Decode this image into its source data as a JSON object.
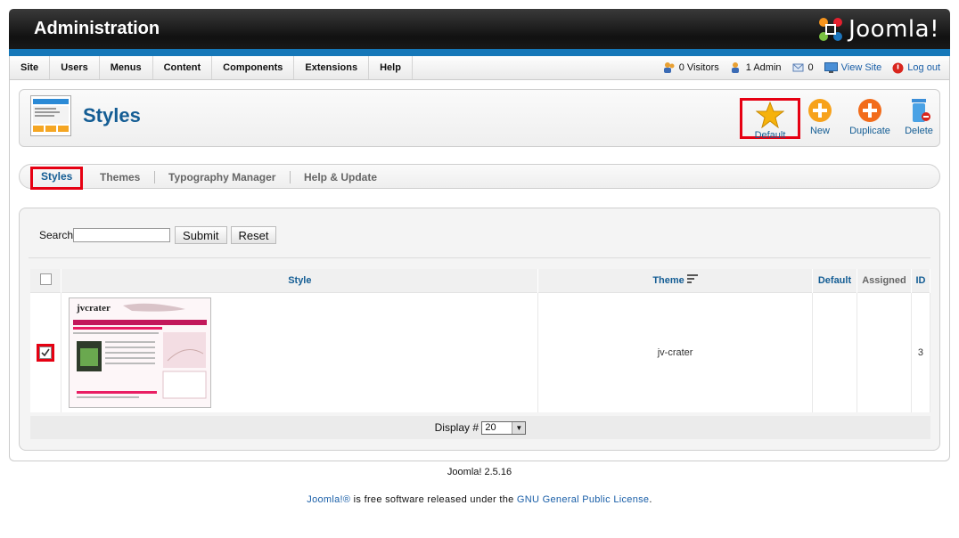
{
  "header": {
    "title": "Administration",
    "logo_text": "Joomla!"
  },
  "menu": {
    "items": [
      "Site",
      "Users",
      "Menus",
      "Content",
      "Components",
      "Extensions",
      "Help"
    ]
  },
  "status": {
    "visitors": "0 Visitors",
    "admin": "1 Admin",
    "messages": "0",
    "view_site": "View Site",
    "logout": "Log out"
  },
  "page": {
    "title": "Styles"
  },
  "toolbar": {
    "default": "Default",
    "new": "New",
    "duplicate": "Duplicate",
    "delete": "Delete"
  },
  "tabs": [
    "Styles",
    "Themes",
    "Typography Manager",
    "Help & Update"
  ],
  "search": {
    "label": "Search",
    "value": "",
    "submit": "Submit",
    "reset": "Reset"
  },
  "table": {
    "headers": {
      "style": "Style",
      "theme": "Theme",
      "default": "Default",
      "assigned": "Assigned",
      "id": "ID"
    },
    "rows": [
      {
        "theme": "jv-crater",
        "default": "",
        "assigned": "",
        "id": "3",
        "checked": true,
        "thumb_brand": "jvcrater"
      }
    ]
  },
  "pagination": {
    "label": "Display #",
    "value": "20"
  },
  "footer": {
    "version": "Joomla! 2.5.16",
    "license_prefix": "Joomla!®",
    "license_middle": " is free software released under the ",
    "license_link": "GNU General Public License",
    "license_suffix": "."
  },
  "colors": {
    "accent": "#145d94",
    "highlight": "#e60012",
    "header_bar": "#1577b8"
  }
}
